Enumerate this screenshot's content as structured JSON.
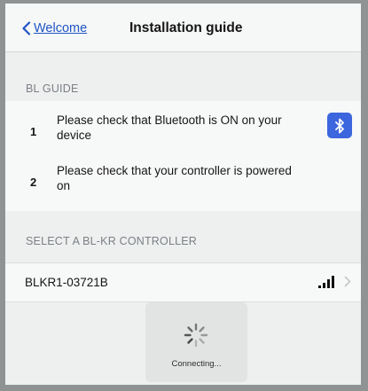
{
  "nav": {
    "back_label": "Welcome",
    "title": "Installation guide"
  },
  "guide": {
    "header": "BL GUIDE",
    "steps": [
      {
        "number": "1",
        "text": "Please check that Bluetooth is ON on your device"
      },
      {
        "number": "2",
        "text": "Please check that your controller is powered on"
      }
    ]
  },
  "controllers": {
    "header": "SELECT A BL-KR CONTROLLER",
    "items": [
      {
        "name": "BLKR1-03721B"
      }
    ]
  },
  "status": {
    "text": "Connecting..."
  },
  "icons": [
    "back-chevron-icon",
    "bluetooth-icon",
    "signal-strength-icon",
    "chevron-right-icon",
    "spinner-icon"
  ],
  "colors": {
    "accent": "#1f55c4",
    "bluetooth_badge": "#3c66dd"
  }
}
